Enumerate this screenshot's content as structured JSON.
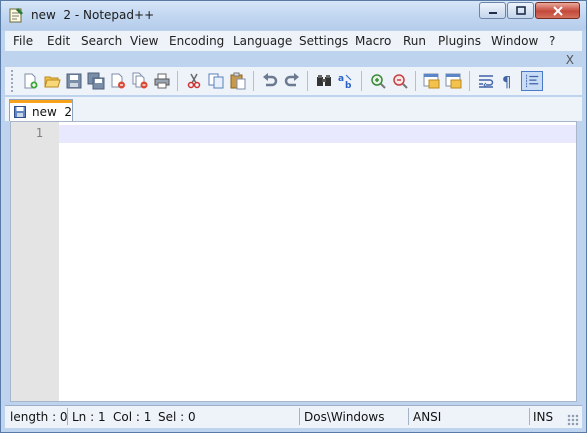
{
  "window": {
    "title": "new  2 - Notepad++"
  },
  "window_controls": {
    "minimize": "minimize-icon",
    "maximize": "maximize-icon",
    "close": "close-icon"
  },
  "menu": {
    "items": [
      "File",
      "Edit",
      "Search",
      "View",
      "Encoding",
      "Language",
      "Settings",
      "Macro",
      "Run",
      "Plugins",
      "Window",
      "?"
    ],
    "close_doc": "X"
  },
  "toolbar": {
    "buttons": [
      "new-file-icon",
      "open-file-icon",
      "save-icon",
      "save-all-icon",
      "close-icon",
      "close-all-icon",
      "print-icon",
      "cut-icon",
      "copy-icon",
      "paste-icon",
      "undo-icon",
      "redo-icon",
      "find-icon",
      "replace-icon",
      "zoom-in-icon",
      "zoom-out-icon",
      "sync-vertical-icon",
      "sync-horizontal-icon",
      "word-wrap-icon",
      "show-all-chars-icon",
      "indent-guide-icon"
    ]
  },
  "tabs": [
    {
      "label": "new  2",
      "icon": "saved-doc-icon",
      "active": true
    }
  ],
  "editor": {
    "line_numbers": [
      "1"
    ],
    "content": ""
  },
  "statusbar": {
    "length": "length : 0",
    "ln": "Ln : 1",
    "col": "Col : 1",
    "sel": "Sel : 0",
    "eol": "Dos\\Windows",
    "encoding": "ANSI",
    "mode": "INS"
  },
  "colors": {
    "accent_tab": "#f6a21a",
    "current_line": "#e8e8ff",
    "chrome": "#bdd3ee"
  }
}
